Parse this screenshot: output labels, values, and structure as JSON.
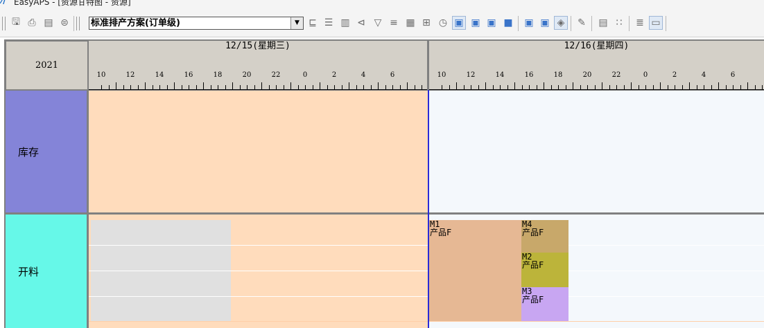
{
  "window": {
    "app_icon": "easyaps-logo-icon",
    "title": "EasyAPS - [资源甘特图 - 资源]"
  },
  "toolbar": {
    "icons_left": [
      "save-icon",
      "print-icon",
      "print-preview-icon",
      "print-setup-icon"
    ],
    "plan_select": {
      "value": "标准排产方案(订单级)"
    },
    "icons_right": [
      "align-icon",
      "list-icon",
      "document-icon",
      "indent-icon",
      "filter-icon",
      "menu-icon",
      "calendar-icon",
      "chart-settings-icon",
      "clock-icon",
      "gantt-view-1-icon",
      "gantt-view-2-icon",
      "gantt-view-3-icon",
      "gantt-view-4-icon",
      "gantt-view-5-icon",
      "gantt-view-6-icon",
      "layers-icon",
      "edit-icon",
      "resource-icon",
      "grid-icon",
      "text-align-icon",
      "report-icon"
    ]
  },
  "gantt": {
    "year": "2021",
    "days": [
      {
        "label": "12/15(星期三)",
        "hours": [
          "10",
          "12",
          "14",
          "16",
          "18",
          "20",
          "22",
          "0",
          "2",
          "4",
          "6"
        ]
      },
      {
        "label": "12/16(星期四)",
        "hours": [
          "10",
          "12",
          "14",
          "16",
          "18",
          "20",
          "22",
          "0",
          "2",
          "4",
          "6"
        ]
      }
    ],
    "resources": [
      {
        "name": "库存"
      },
      {
        "name": "开料"
      }
    ],
    "tasks": [
      {
        "id": "M1",
        "product": "产品F",
        "color": "#e6b894"
      },
      {
        "id": "M4",
        "product": "产品F",
        "color": "#c8a86a"
      },
      {
        "id": "M2",
        "product": "产品F",
        "color": "#bcb43a"
      },
      {
        "id": "M3",
        "product": "产品F",
        "color": "#c8a6f2"
      }
    ],
    "colors": {
      "past_zone": "#ffdcbc",
      "future_zone": "#f4f8fc",
      "resource_label_1": "#8484d8",
      "resource_label_2": "#66f8e8",
      "today_line": "#2a2ad8",
      "idle_block": "#e0e0e0"
    }
  }
}
